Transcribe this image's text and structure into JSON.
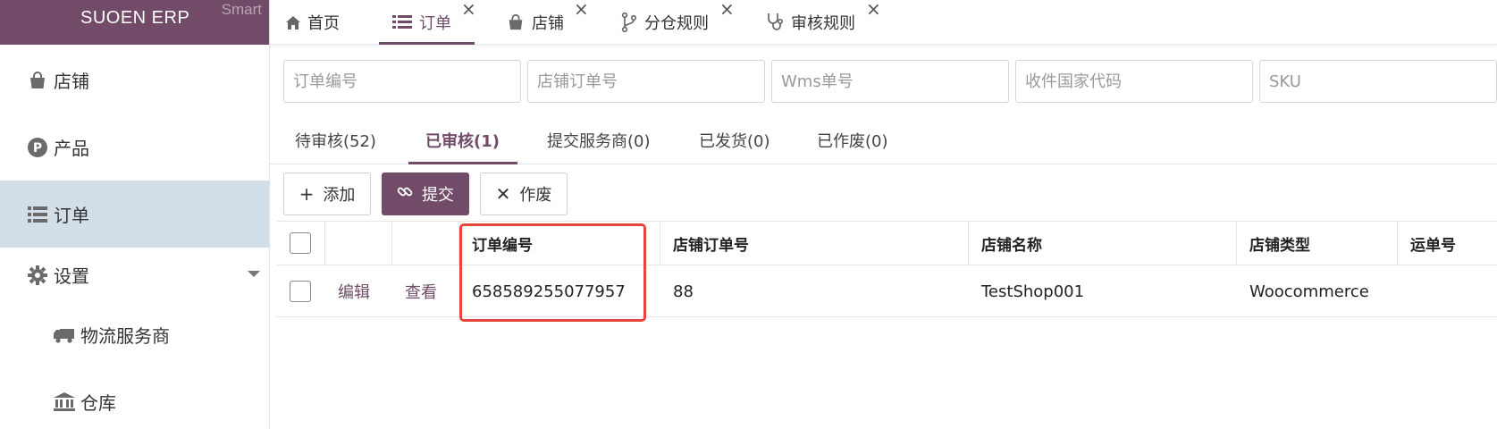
{
  "brand": {
    "name": "SUOEN ERP",
    "tag": "Smart"
  },
  "sidebar": {
    "items": [
      {
        "label": "店铺",
        "icon": "shopping-bag-icon"
      },
      {
        "label": "产品",
        "icon": "product-p-icon"
      },
      {
        "label": "订单",
        "icon": "list-icon",
        "active": true
      },
      {
        "label": "设置",
        "icon": "gear-icon"
      },
      {
        "label": "物流服务商",
        "icon": "truck-icon"
      },
      {
        "label": "仓库",
        "icon": "bank-icon"
      }
    ]
  },
  "tabs": [
    {
      "label": "首页",
      "icon": "home-icon"
    },
    {
      "label": "订单",
      "icon": "list-icon",
      "active": true
    },
    {
      "label": "店铺",
      "icon": "shopping-bag-icon"
    },
    {
      "label": "分仓规则",
      "icon": "branch-icon"
    },
    {
      "label": "审核规则",
      "icon": "stethoscope-icon"
    }
  ],
  "search": {
    "order_no": "订单编号",
    "shop_order_no": "店铺订单号",
    "wms_no": "Wms单号",
    "country_code": "收件国家代码",
    "sku": "SKU"
  },
  "status_tabs": [
    {
      "label": "待审核(52)"
    },
    {
      "label": "已审核(1)",
      "active": true
    },
    {
      "label": "提交服务商(0)"
    },
    {
      "label": "已发货(0)"
    },
    {
      "label": "已作废(0)"
    }
  ],
  "toolbar": {
    "add": "添加",
    "submit": "提交",
    "void": "作废"
  },
  "table": {
    "headers": {
      "order_no": "订单编号",
      "shop_order_no": "店铺订单号",
      "shop_name": "店铺名称",
      "shop_type": "店铺类型",
      "tracking_no": "运单号"
    },
    "rows": [
      {
        "edit": "编辑",
        "view": "查看",
        "order_no": "658589255077957",
        "shop_order_no": "88",
        "shop_name": "TestShop001",
        "shop_type": "Woocommerce",
        "tracking_no": ""
      }
    ]
  },
  "colors": {
    "brand": "#714b67",
    "active_nav": "#d3dfe8",
    "highlight": "#e8453c"
  }
}
